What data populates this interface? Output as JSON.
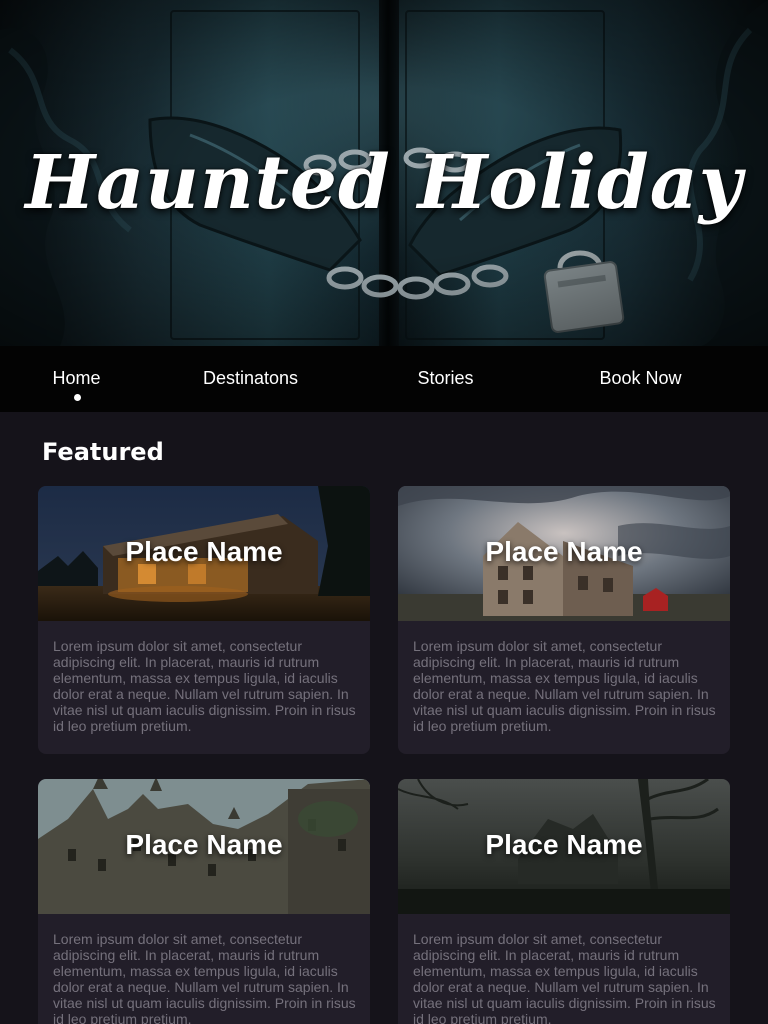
{
  "hero": {
    "title": "Haunted Holiday"
  },
  "nav": {
    "items": [
      {
        "label": "Home",
        "active": true
      },
      {
        "label": "Destinatons",
        "active": false
      },
      {
        "label": "Stories",
        "active": false
      },
      {
        "label": "Book Now",
        "active": false
      }
    ]
  },
  "main": {
    "section_title": "Featured",
    "cards": [
      {
        "place": "Place Name",
        "description": "Lorem ipsum dolor sit amet, consectetur adipiscing elit. In placerat, mauris id rutrum elementum, massa ex tempus ligula, id iaculis dolor erat a neque. Nullam vel rutrum sapien. In vitae nisl ut quam iaculis dignissim. Proin in risus id leo pretium pretium."
      },
      {
        "place": "Place Name",
        "description": "Lorem ipsum dolor sit amet, consectetur adipiscing elit. In placerat, mauris id rutrum elementum, massa ex tempus ligula, id iaculis dolor erat a neque. Nullam vel rutrum sapien. In vitae nisl ut quam iaculis dignissim. Proin in risus id leo pretium pretium."
      },
      {
        "place": "Place Name",
        "description": "Lorem ipsum dolor sit amet, consectetur adipiscing elit. In placerat, mauris id rutrum elementum, massa ex tempus ligula, id iaculis dolor erat a neque. Nullam vel rutrum sapien. In vitae nisl ut quam iaculis dignissim. Proin in risus id leo pretium pretium."
      },
      {
        "place": "Place Name",
        "description": "Lorem ipsum dolor sit amet, consectetur adipiscing elit. In placerat, mauris id rutrum elementum, massa ex tempus ligula, id iaculis dolor erat a neque. Nullam vel rutrum sapien. In vitae nisl ut quam iaculis dignissim. Proin in risus id leo pretium pretium."
      }
    ]
  },
  "colors": {
    "background": "#15131a",
    "nav_background": "#030303",
    "card_background": "#221e29",
    "body_text": "#75717c"
  }
}
